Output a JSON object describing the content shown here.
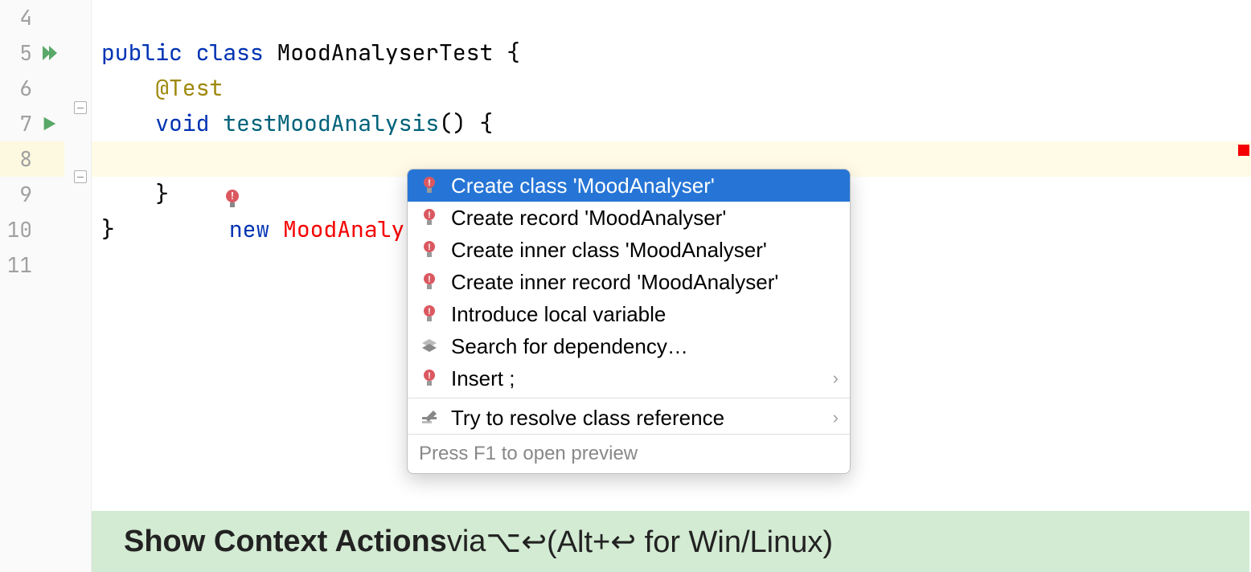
{
  "gutter": {
    "lines": [
      "4",
      "5",
      "6",
      "7",
      "8",
      "9",
      "10",
      "11"
    ]
  },
  "code": {
    "l5_public": "public",
    "l5_class": "class",
    "l5_name": "MoodAnalyserTest",
    "l5_brace": " {",
    "l6_ann": "@Test",
    "l7_void": "void",
    "l7_mname": "testMoodAnalysis",
    "l7_tail": "() {",
    "l8_new": "new",
    "l8_err": "MoodAnalyser",
    "l9_brace": "}",
    "l10_brace": "}"
  },
  "popup": {
    "items": [
      {
        "label": "Create class 'MoodAnalyser'",
        "icon": "bulb-red",
        "selected": true
      },
      {
        "label": "Create record 'MoodAnalyser'",
        "icon": "bulb-red",
        "selected": false
      },
      {
        "label": "Create inner class 'MoodAnalyser'",
        "icon": "bulb-red",
        "selected": false
      },
      {
        "label": "Create inner record 'MoodAnalyser'",
        "icon": "bulb-red",
        "selected": false
      },
      {
        "label": "Introduce local variable",
        "icon": "bulb-red",
        "selected": false
      },
      {
        "label": "Search for dependency…",
        "icon": "layers",
        "selected": false
      },
      {
        "label": "Insert ;",
        "icon": "bulb-red",
        "selected": false,
        "submenu": true
      }
    ],
    "sep_after_index": 6,
    "extra": {
      "label": "Try to resolve class reference",
      "icon": "pencil",
      "submenu": true
    },
    "footer": "Press F1 to open preview"
  },
  "hint": {
    "bold": "Show Context Actions",
    "rest_1": " via ",
    "shortcut_mac": "⌥↩",
    "rest_2": " (Alt+↩ for Win/Linux)"
  }
}
